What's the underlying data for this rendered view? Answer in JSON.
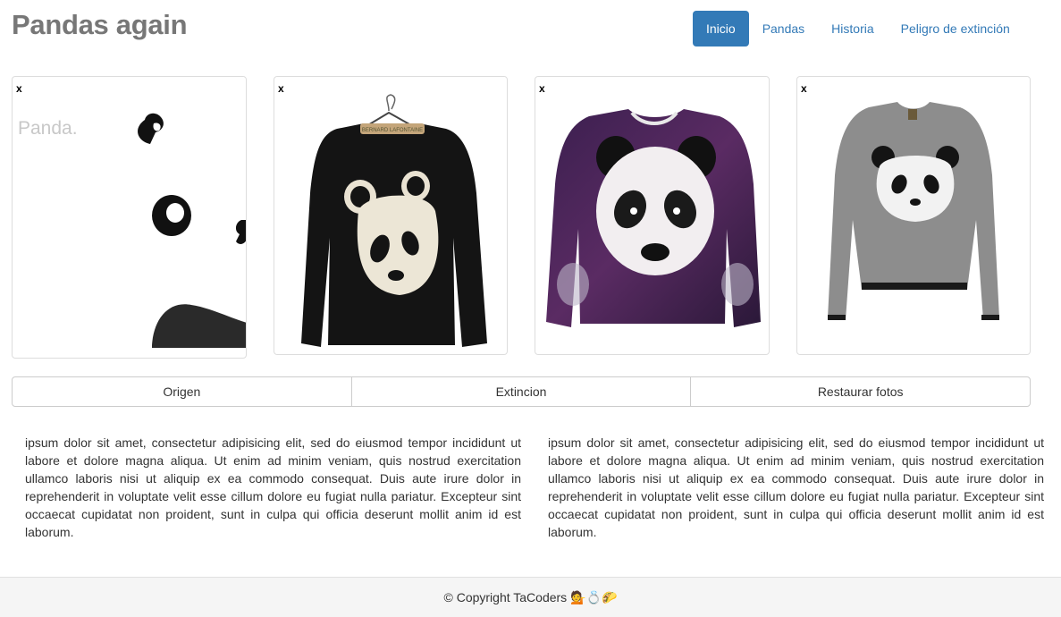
{
  "header": {
    "title": "Pandas again",
    "nav": [
      {
        "label": "Inicio",
        "active": true
      },
      {
        "label": "Pandas",
        "active": false
      },
      {
        "label": "Historia",
        "active": false
      },
      {
        "label": "Peligro de extinción",
        "active": false
      }
    ]
  },
  "gallery": {
    "close_label": "x",
    "cards": [
      {
        "name": "panda-logo-image",
        "logo_text": "Panda."
      },
      {
        "name": "black-panda-sweater-image",
        "hanger_text": "BERNARD LAFONTAINE"
      },
      {
        "name": "galaxy-panda-sweater-image"
      },
      {
        "name": "grey-panda-sweater-image"
      }
    ]
  },
  "buttons": {
    "origen": "Origen",
    "extincion": "Extincion",
    "restaurar": "Restaurar fotos"
  },
  "content": {
    "left": "ipsum dolor sit amet, consectetur adipisicing elit, sed do eiusmod tempor incididunt ut labore et dolore magna aliqua. Ut enim ad minim veniam, quis nostrud exercitation ullamco laboris nisi ut aliquip ex ea commodo consequat. Duis aute irure dolor in reprehenderit in voluptate velit esse cillum dolore eu fugiat nulla pariatur. Excepteur sint occaecat cupidatat non proident, sunt in culpa qui officia deserunt mollit anim id est laborum.",
    "right": "ipsum dolor sit amet, consectetur adipisicing elit, sed do eiusmod tempor incididunt ut labore et dolore magna aliqua. Ut enim ad minim veniam, quis nostrud exercitation ullamco laboris nisi ut aliquip ex ea commodo consequat. Duis aute irure dolor in reprehenderit in voluptate velit esse cillum dolore eu fugiat nulla pariatur. Excepteur sint occaecat cupidatat non proident, sunt in culpa qui officia deserunt mollit anim id est laborum."
  },
  "footer": {
    "copyright": "© Copyright TaCoders",
    "emoji": "💁💍🌮"
  },
  "colors": {
    "accent": "#337ab7",
    "title": "#777777",
    "footer_bg": "#f5f5f5"
  }
}
